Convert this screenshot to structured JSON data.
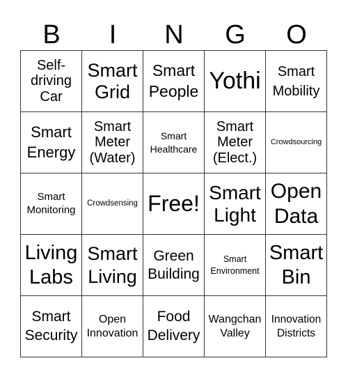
{
  "header": [
    "B",
    "I",
    "N",
    "G",
    "O"
  ],
  "cells": [
    [
      "Self-driving Car",
      "Smart Grid",
      "Smart People",
      "Yothi",
      "Smart Mobility"
    ],
    [
      "Smart Energy",
      "Smart Meter (Water)",
      "Smart Healthcare",
      "Smart Meter (Elect.)",
      "Crowdsourcing"
    ],
    [
      "Smart Monitoring",
      "Crowdsensing",
      "Free!",
      "Smart Light",
      "Open Data"
    ],
    [
      "Living Labs",
      "Smart Living",
      "Green Building",
      "Smart Environment",
      "Smart Bin"
    ],
    [
      "Smart Security",
      "Open Innovation",
      "Food Delivery",
      "Wangchan Valley",
      "Innovation Districts"
    ]
  ]
}
